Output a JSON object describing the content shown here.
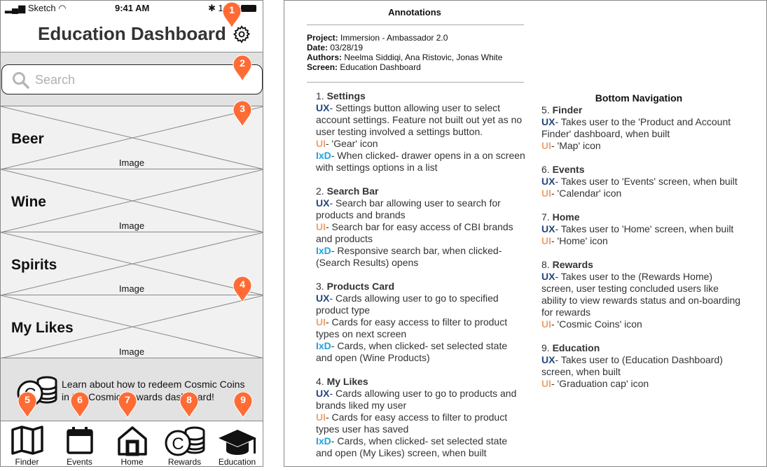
{
  "phone": {
    "status": {
      "carrier": "Sketch",
      "time": "9:41 AM",
      "battery_label": "100%"
    },
    "header": {
      "title": "Education Dashboard",
      "settings_icon": "gear-icon"
    },
    "search": {
      "placeholder": "Search"
    },
    "cards": [
      {
        "name": "Beer",
        "image_label": "Image"
      },
      {
        "name": "Wine",
        "image_label": "Image"
      },
      {
        "name": "Spirits",
        "image_label": "Image"
      },
      {
        "name": "My Likes",
        "image_label": "Image"
      }
    ],
    "promo": {
      "line1": "Learn about how to redeem Cosmic Coins",
      "line2": "in the Cosmic Rewards dashboard!",
      "icon": "coins-icon"
    },
    "nav": [
      {
        "label": "Finder",
        "icon": "map-icon"
      },
      {
        "label": "Events",
        "icon": "calendar-icon"
      },
      {
        "label": "Home",
        "icon": "home-icon"
      },
      {
        "label": "Rewards",
        "icon": "coins-icon"
      },
      {
        "label": "Education",
        "icon": "graduation-cap-icon"
      }
    ],
    "markers": [
      "1",
      "2",
      "3",
      "4",
      "5",
      "6",
      "7",
      "8",
      "9"
    ],
    "marker_color": "#ff6b35"
  },
  "annotations": {
    "title": "Annotations",
    "meta": [
      {
        "key": "Project:",
        "value": " Immersion - Ambassador 2.0"
      },
      {
        "key": "Date:",
        "value": " 03/28/19"
      },
      {
        "key": "Authors:",
        "value": " Neelma Siddiqi, Ana Ristovic, Jonas White"
      },
      {
        "key": "Screen:",
        "value": " Education Dashboard"
      }
    ],
    "bottom_nav_heading": "Bottom Navigation",
    "colors": {
      "UX": "#23467e",
      "UI": "#f0a36f",
      "IxD": "#1ea3e0"
    },
    "left": [
      {
        "num": "1. ",
        "title": "Settings",
        "items": [
          {
            "tag": "UX",
            "text": "- Settings button allowing user to select account settings. Feature not built out yet as no user testing involved a settings button."
          },
          {
            "tag": "UI",
            "text": "- 'Gear' icon"
          },
          {
            "tag": "IxD",
            "text": "- When clicked- drawer opens in a on screen with settings options in a list"
          }
        ]
      },
      {
        "num": "2. ",
        "title": "Search Bar",
        "items": [
          {
            "tag": "UX",
            "text": "- Search bar allowing user to search for products and brands"
          },
          {
            "tag": "UI",
            "text": "- Search bar for easy access of CBI brands and products"
          },
          {
            "tag": "IxD",
            "text": "- Responsive search bar, when clicked- (Search Results) opens"
          }
        ]
      },
      {
        "num": "3. ",
        "title": "Products Card",
        "items": [
          {
            "tag": "UX",
            "text": "- Cards allowing user to go to specified product type"
          },
          {
            "tag": "UI",
            "text": "- Cards for easy access to filter to product types on next screen"
          },
          {
            "tag": "IxD",
            "text": "- Cards, when clicked- set selected state and open (Wine Products)"
          }
        ]
      },
      {
        "num": "4. ",
        "title": "My Likes",
        "items": [
          {
            "tag": "UX",
            "text": "- Cards allowing user to go to products and brands liked my user"
          },
          {
            "tag": "UI",
            "text": "- Cards for easy access to filter to product types user has saved"
          },
          {
            "tag": "IxD",
            "text": "- Cards, when clicked- set selected state and open (My Likes) screen, when built"
          }
        ]
      }
    ],
    "right": [
      {
        "num": "5. ",
        "title": "Finder",
        "items": [
          {
            "tag": "UX",
            "text": "- Takes user to the 'Product and Account Finder' dashboard, when built"
          },
          {
            "tag": "UI",
            "text": "- 'Map' icon"
          }
        ]
      },
      {
        "num": "6. ",
        "title": "Events",
        "items": [
          {
            "tag": "UX",
            "text": "- Takes user to 'Events' screen, when built"
          },
          {
            "tag": "UI",
            "text": "- 'Calendar' icon"
          }
        ]
      },
      {
        "num": "7. ",
        "title": "Home",
        "items": [
          {
            "tag": "UX",
            "text": "- Takes user to 'Home' screen, when built"
          },
          {
            "tag": "UI",
            "text": "- 'Home' icon"
          }
        ]
      },
      {
        "num": "8. ",
        "title": "Rewards",
        "items": [
          {
            "tag": "UX",
            "text": "- Takes user to the (Rewards Home) screen, user testing concluded users like ability to view rewards status and on-boarding for rewards"
          },
          {
            "tag": "UI",
            "text": "- 'Cosmic Coins' icon"
          }
        ]
      },
      {
        "num": "9. ",
        "title": "Education",
        "items": [
          {
            "tag": "UX",
            "text": "- Takes user to (Education Dashboard) screen, when built"
          },
          {
            "tag": "UI",
            "text": "- 'Graduation cap' icon"
          }
        ]
      }
    ]
  }
}
